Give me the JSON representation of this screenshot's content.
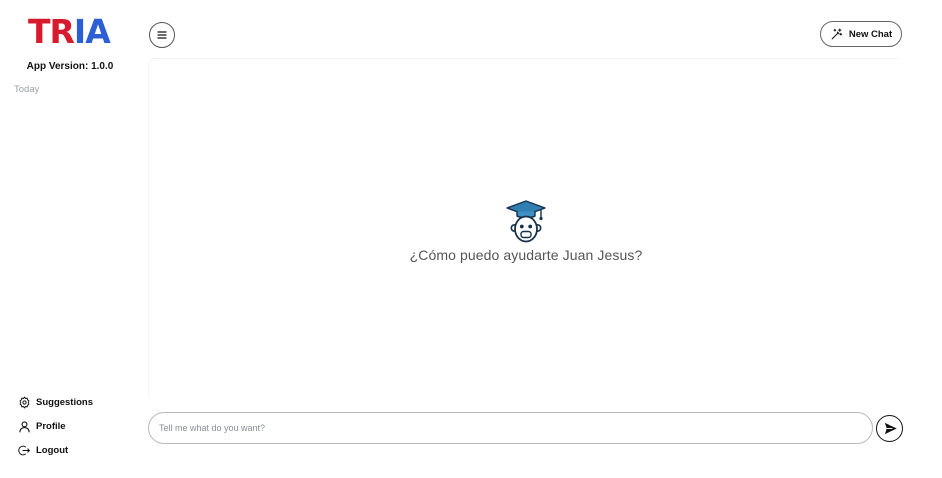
{
  "sidebar": {
    "logo": {
      "part1": "TR",
      "part2": "IA"
    },
    "app_version": "App Version: 1.0.0",
    "section_label": "Today",
    "menu": [
      {
        "label": "Suggestions",
        "icon": "gear-icon"
      },
      {
        "label": "Profile",
        "icon": "user-icon"
      },
      {
        "label": "Logout",
        "icon": "logout-icon"
      }
    ]
  },
  "header": {
    "new_chat_label": "New Chat"
  },
  "main": {
    "welcome_text": "¿Cómo puedo ayudarte Juan Jesus?"
  },
  "composer": {
    "placeholder": "Tell me what do you want?"
  },
  "colors": {
    "logo_red": "#d81b2c",
    "logo_blue": "#2c5fd6",
    "bot_cap": "#2f7fb3"
  }
}
